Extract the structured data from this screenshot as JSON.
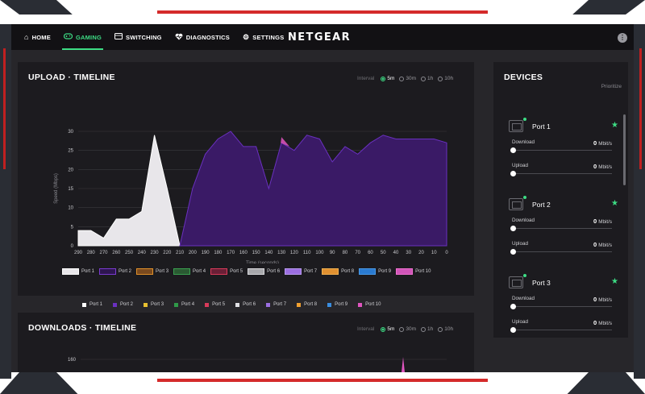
{
  "nav": {
    "items": [
      {
        "label": "HOME",
        "icon": "home-icon"
      },
      {
        "label": "GAMING",
        "icon": "gamepad-icon"
      },
      {
        "label": "SWITCHING",
        "icon": "switch-icon"
      },
      {
        "label": "DIAGNOSTICS",
        "icon": "heartbeat-icon"
      },
      {
        "label": "SETTINGS",
        "icon": "gear-icon"
      }
    ],
    "active": "GAMING",
    "brand": "NETGEAR",
    "more_icon": "more-icon"
  },
  "colors": {
    "accent": "#3ddc84",
    "background": "#27262a",
    "panel": "#1c1b1f",
    "topbar": "#121114"
  },
  "upload": {
    "title": "UPLOAD · TIMELINE",
    "interval_label": "Interval",
    "interval_options": [
      "5m",
      "30m",
      "1h",
      "10h"
    ],
    "interval_selected": "5m"
  },
  "downloads": {
    "title": "DOWNLOADS · TIMELINE",
    "interval_label": "Interval",
    "interval_options": [
      "5m",
      "30m",
      "1h",
      "10h"
    ],
    "interval_selected": "5m",
    "y_top_tick": "160"
  },
  "chart_data": {
    "type": "area",
    "title": "UPLOAD · TIMELINE",
    "xlabel": "Time (seconds)",
    "ylabel": "Speed (Mbps)",
    "x": [
      290,
      280,
      270,
      260,
      250,
      240,
      230,
      220,
      210,
      200,
      190,
      180,
      170,
      160,
      150,
      140,
      130,
      120,
      110,
      100,
      90,
      80,
      70,
      60,
      50,
      40,
      30,
      20,
      10,
      0
    ],
    "x_reversed": true,
    "ylim": [
      0,
      30
    ],
    "yticks": [
      0,
      5,
      10,
      15,
      20,
      25,
      30
    ],
    "grid": true,
    "series": [
      {
        "name": "Port 1",
        "color": "#e8e6ea",
        "values": [
          4,
          4,
          2,
          7,
          7,
          9,
          29,
          15,
          0,
          null,
          null,
          null,
          null,
          null,
          null,
          null,
          null,
          null,
          null,
          null,
          null,
          null,
          null,
          null,
          null,
          null,
          null,
          null,
          null,
          null
        ]
      },
      {
        "name": "Port 2",
        "color": "#4b2080",
        "values": [
          null,
          null,
          null,
          null,
          null,
          null,
          null,
          null,
          0,
          15,
          24,
          28,
          30,
          26,
          26,
          15,
          27,
          25,
          29,
          28,
          22,
          26,
          24,
          27,
          29,
          28,
          28,
          28,
          28,
          27
        ]
      },
      {
        "name": "Port 3",
        "color": "#e8c030",
        "values": []
      },
      {
        "name": "Port 4",
        "color": "#2f9a48",
        "values": []
      },
      {
        "name": "Port 5",
        "color": "#d83a5a",
        "values": []
      },
      {
        "name": "Port 6",
        "color": "#d8d8dc",
        "values": []
      },
      {
        "name": "Port 7",
        "color": "#9b6ee0",
        "values": []
      },
      {
        "name": "Port 8",
        "color": "#f0a030",
        "values": []
      },
      {
        "name": "Port 9",
        "color": "#3a8ee0",
        "values": []
      },
      {
        "name": "Port 10",
        "color": "#e055c0",
        "values": [
          null,
          null,
          null,
          null,
          null,
          null,
          null,
          null,
          null,
          null,
          null,
          null,
          null,
          null,
          null,
          null,
          28.5,
          null,
          null,
          null,
          null,
          null,
          null,
          null,
          null,
          null,
          null,
          null,
          null,
          null
        ]
      }
    ],
    "legend_top": [
      {
        "name": "Port 1",
        "fill": "#e8e6ea",
        "stroke": "#ffffff"
      },
      {
        "name": "Port 2",
        "fill": "#2e1650",
        "stroke": "#7a3ad0"
      },
      {
        "name": "Port 3",
        "fill": "#7a4a1e",
        "stroke": "#e0902a"
      },
      {
        "name": "Port 4",
        "fill": "#2a5a32",
        "stroke": "#3aa050"
      },
      {
        "name": "Port 5",
        "fill": "#6a1f36",
        "stroke": "#d83a5a"
      },
      {
        "name": "Port 6",
        "fill": "#a8a8ac",
        "stroke": "#d8d8dc"
      },
      {
        "name": "Port 7",
        "fill": "#9b6ee0",
        "stroke": "#b99af0"
      },
      {
        "name": "Port 8",
        "fill": "#e09030",
        "stroke": "#f0b050"
      },
      {
        "name": "Port 9",
        "fill": "#2a7ad0",
        "stroke": "#4a9ae8"
      },
      {
        "name": "Port 10",
        "fill": "#d055b8",
        "stroke": "#f070d0"
      }
    ],
    "legend_bottom": [
      {
        "name": "Port 1",
        "color": "#ffffff"
      },
      {
        "name": "Port 2",
        "color": "#6a30c0"
      },
      {
        "name": "Port 3",
        "color": "#e8c030"
      },
      {
        "name": "Port 4",
        "color": "#2f9a48"
      },
      {
        "name": "Port 5",
        "color": "#d83a5a"
      },
      {
        "name": "Port 6",
        "color": "#e0e0e4"
      },
      {
        "name": "Port 7",
        "color": "#9b6ee0"
      },
      {
        "name": "Port 8",
        "color": "#f0a030"
      },
      {
        "name": "Port 9",
        "color": "#3a8ee0"
      },
      {
        "name": "Port 10",
        "color": "#e055c0"
      }
    ]
  },
  "devices": {
    "title": "DEVICES",
    "prioritize_label": "Prioritize",
    "download_label": "Download",
    "upload_label": "Upload",
    "unit": "Mbit/s",
    "list": [
      {
        "name": "Port 1",
        "download": "0",
        "upload": "0",
        "prioritized": true
      },
      {
        "name": "Port 2",
        "download": "0",
        "upload": "0",
        "prioritized": true
      },
      {
        "name": "Port 3",
        "download": "0",
        "upload": "0",
        "prioritized": true
      }
    ]
  }
}
